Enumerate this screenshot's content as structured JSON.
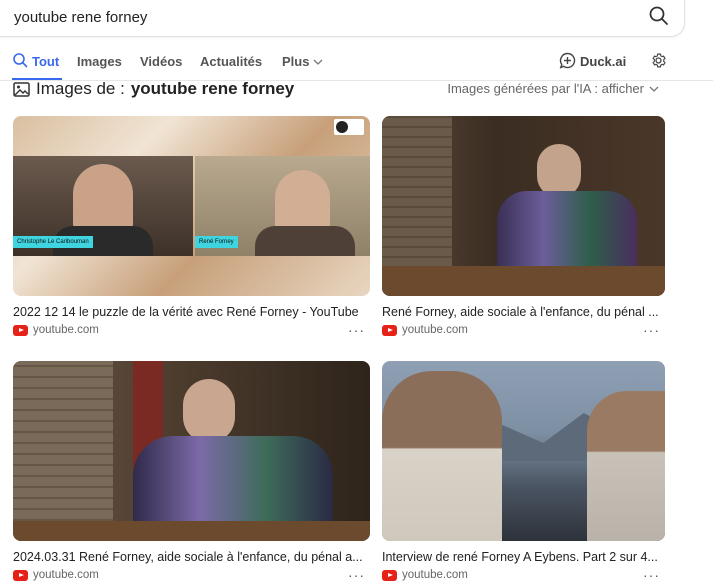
{
  "search": {
    "query": "youtube rene forney"
  },
  "nav": {
    "tabs": [
      {
        "label": "Tout"
      },
      {
        "label": "Images"
      },
      {
        "label": "Vidéos"
      },
      {
        "label": "Actualités"
      },
      {
        "label": "Plus"
      }
    ],
    "duckai_label": "Duck.ai"
  },
  "section": {
    "prefix": "Images de :",
    "query": "youtube rene forney",
    "ai_toggle": "Images générées par l'IA : afficher"
  },
  "results": [
    {
      "caption": "2022 12 14 le puzzle de la vérité avec René Forney - YouTube",
      "source": "youtube.com",
      "overlay_left": "Christophe Le Caribouman",
      "overlay_right": "René Forney"
    },
    {
      "caption": "René Forney, aide sociale à l'enfance, du pénal ...",
      "source": "youtube.com"
    },
    {
      "caption": "2024.03.31 René Forney, aide sociale à l'enfance, du pénal a...",
      "source": "youtube.com"
    },
    {
      "caption": "Interview de rené Forney A Eybens. Part 2 sur 4...",
      "source": "youtube.com"
    }
  ]
}
